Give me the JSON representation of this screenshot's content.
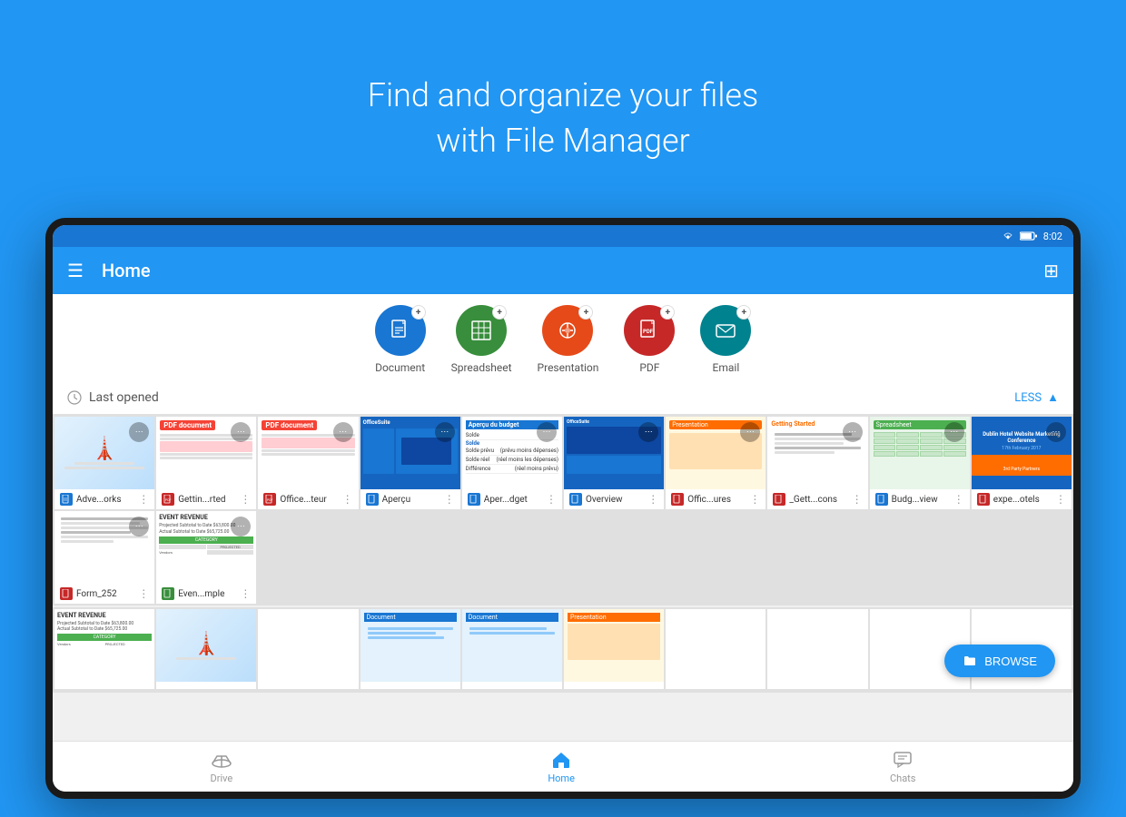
{
  "background": {
    "headline1": "Find and organize your files",
    "headline2": "with File Manager",
    "color": "#2196F3"
  },
  "status_bar": {
    "time": "8:02"
  },
  "app_bar": {
    "title": "Home"
  },
  "create_items": [
    {
      "id": "document",
      "label": "Document",
      "color": "#1976D2",
      "icon": "📄"
    },
    {
      "id": "spreadsheet",
      "label": "Spreadsheet",
      "color": "#388E3C",
      "icon": "⊞"
    },
    {
      "id": "presentation",
      "label": "Presentation",
      "color": "#E64A19",
      "icon": "◈"
    },
    {
      "id": "pdf",
      "label": "PDF",
      "color": "#C62828",
      "icon": "📑"
    },
    {
      "id": "email",
      "label": "Email",
      "color": "#00838F",
      "icon": "✉"
    }
  ],
  "section_header": {
    "label": "Last opened",
    "action": "LESS"
  },
  "files": [
    {
      "name": "Adve...orks",
      "type": "doc",
      "thumb": "travel"
    },
    {
      "name": "Gettin...rted",
      "type": "pdf",
      "thumb": "pdf1"
    },
    {
      "name": "Office...teur",
      "type": "pdf",
      "thumb": "pdf2"
    },
    {
      "name": "Aperçu",
      "type": "doc",
      "thumb": "officesuite"
    },
    {
      "name": "Aper...dget",
      "type": "doc",
      "thumb": "budget_fr"
    },
    {
      "name": "Overview",
      "type": "doc",
      "thumb": "overview"
    },
    {
      "name": "Offic...ures",
      "type": "pdf",
      "thumb": "presentation_thumb"
    },
    {
      "name": "_Gett...cons",
      "type": "pdf",
      "thumb": "getting_started"
    },
    {
      "name": "Budg...view",
      "type": "doc",
      "thumb": "spreadsheet_thumb"
    },
    {
      "name": "expe...otels",
      "type": "pdf",
      "thumb": "hotel"
    },
    {
      "name": "Form_252",
      "type": "pdf",
      "thumb": "form"
    },
    {
      "name": "Even...mple",
      "type": "doc",
      "thumb": "event"
    }
  ],
  "bottom_nav": [
    {
      "id": "drive",
      "label": "Drive",
      "icon": "drive",
      "active": false
    },
    {
      "id": "home",
      "label": "Home",
      "icon": "home",
      "active": true
    },
    {
      "id": "chats",
      "label": "Chats",
      "icon": "chats",
      "active": false
    }
  ],
  "browse_button": {
    "label": "BROWSE"
  }
}
